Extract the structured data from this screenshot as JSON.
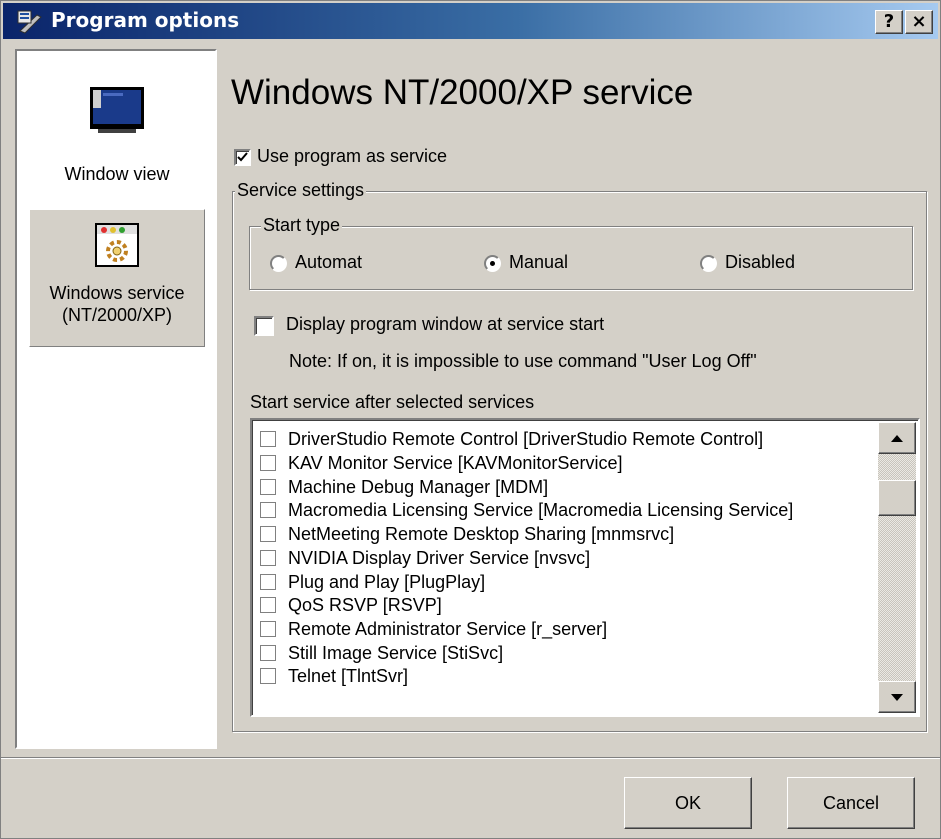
{
  "window": {
    "title": "Program options",
    "title_icon": "program-options-icon",
    "help_label": "?",
    "close_label": "×"
  },
  "sidebar": {
    "items": [
      {
        "label": "Window view",
        "icon": "monitor-icon",
        "selected": false
      },
      {
        "label_line1": "Windows service",
        "label_line2": "(NT/2000/XP)",
        "icon": "service-gear-icon",
        "selected": true
      }
    ]
  },
  "page": {
    "heading": "Windows NT/2000/XP service",
    "use_as_service": {
      "label": "Use program as service",
      "checked": true
    },
    "service_settings": {
      "legend": "Service settings",
      "start_type": {
        "legend": "Start type",
        "options": [
          {
            "label": "Automat",
            "selected": false
          },
          {
            "label": "Manual",
            "selected": true
          },
          {
            "label": "Disabled",
            "selected": false
          }
        ]
      },
      "display_window": {
        "label": "Display program window at service start",
        "checked": false
      },
      "note": "Note: If on, it is impossible to use command \"User Log Off\"",
      "services_label": "Start service after selected services",
      "services": [
        {
          "label": "DriverStudio Remote Control [DriverStudio Remote Control]",
          "checked": false
        },
        {
          "label": "KAV Monitor Service [KAVMonitorService]",
          "checked": false
        },
        {
          "label": "Machine Debug Manager [MDM]",
          "checked": false
        },
        {
          "label": "Macromedia Licensing Service [Macromedia Licensing Service]",
          "checked": false
        },
        {
          "label": "NetMeeting Remote Desktop Sharing [mnmsrvc]",
          "checked": false
        },
        {
          "label": "NVIDIA Display Driver Service [nvsvc]",
          "checked": false
        },
        {
          "label": "Plug and Play [PlugPlay]",
          "checked": false
        },
        {
          "label": "QoS RSVP [RSVP]",
          "checked": false
        },
        {
          "label": "Remote Administrator Service [r_server]",
          "checked": false
        },
        {
          "label": "Still Image Service [StiSvc]",
          "checked": false
        },
        {
          "label": "Telnet [TlntSvr]",
          "checked": false
        }
      ]
    }
  },
  "buttons": {
    "ok": "OK",
    "cancel": "Cancel"
  }
}
